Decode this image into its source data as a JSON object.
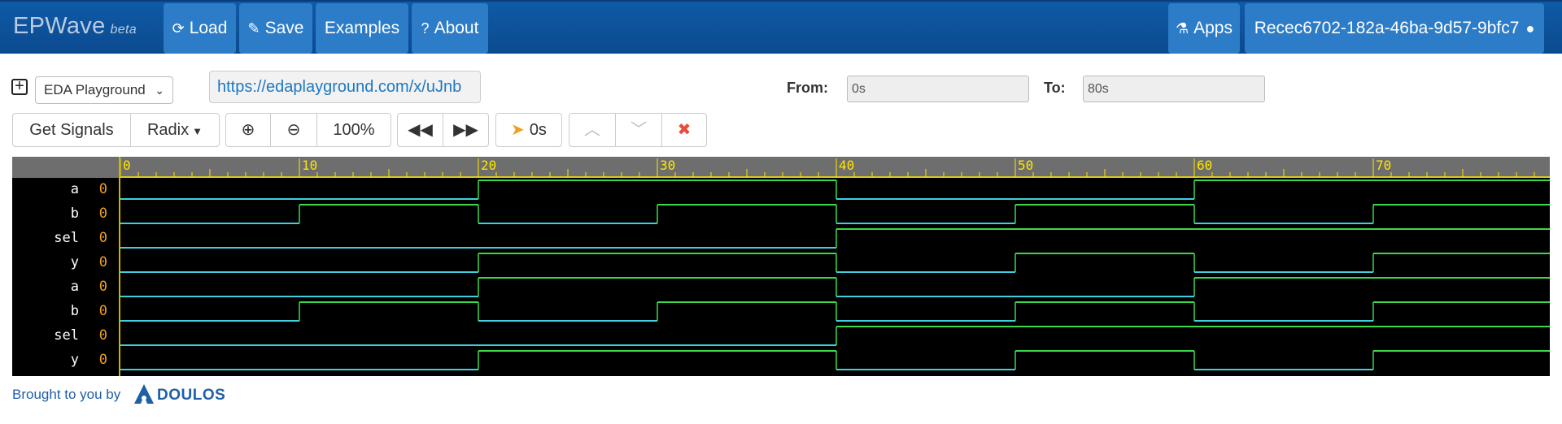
{
  "navbar": {
    "brand": "EPWave",
    "beta": "beta",
    "load": "Load",
    "save": "Save",
    "examples": "Examples",
    "about": "About",
    "apps": "Apps",
    "user": "Recec6702-182a-46ba-9d57-9bfc7"
  },
  "toolbar": {
    "source_select": "EDA Playground",
    "url": "https://edaplayground.com/x/uJnb",
    "from_label": "From:",
    "from_value": "0s",
    "to_label": "To:",
    "to_value": "80s",
    "get_signals": "Get Signals",
    "radix": "Radix",
    "zoom_level": "100%",
    "cursor_time": "0s"
  },
  "wave": {
    "ticks": [
      "0",
      "10",
      "20",
      "30",
      "40",
      "50",
      "60",
      "70"
    ],
    "signals": [
      {
        "name": "a",
        "value": "0",
        "transitions": [
          0,
          0,
          20,
          1,
          40,
          0,
          60,
          1
        ]
      },
      {
        "name": "b",
        "value": "0",
        "transitions": [
          0,
          0,
          10,
          1,
          20,
          0,
          30,
          1,
          40,
          0,
          50,
          1,
          60,
          0,
          70,
          1
        ]
      },
      {
        "name": "sel",
        "value": "0",
        "transitions": [
          0,
          0,
          40,
          1
        ]
      },
      {
        "name": "y",
        "value": "0",
        "transitions": [
          0,
          0,
          20,
          1,
          40,
          0,
          50,
          1,
          60,
          0,
          70,
          1
        ]
      },
      {
        "name": "a",
        "value": "0",
        "transitions": [
          0,
          0,
          20,
          1,
          40,
          0,
          60,
          1
        ]
      },
      {
        "name": "b",
        "value": "0",
        "transitions": [
          0,
          0,
          10,
          1,
          20,
          0,
          30,
          1,
          40,
          0,
          50,
          1,
          60,
          0,
          70,
          1
        ]
      },
      {
        "name": "sel",
        "value": "0",
        "transitions": [
          0,
          0,
          40,
          1
        ]
      },
      {
        "name": "y",
        "value": "0",
        "transitions": [
          0,
          0,
          20,
          1,
          40,
          0,
          50,
          1,
          60,
          0,
          70,
          1
        ]
      }
    ],
    "colors": {
      "low": "#3fd0e0",
      "high": "#3ad94a",
      "ruler_text": "#ffe600"
    }
  },
  "footer": {
    "brought": "Brought to you by",
    "company": "DOULOS"
  }
}
